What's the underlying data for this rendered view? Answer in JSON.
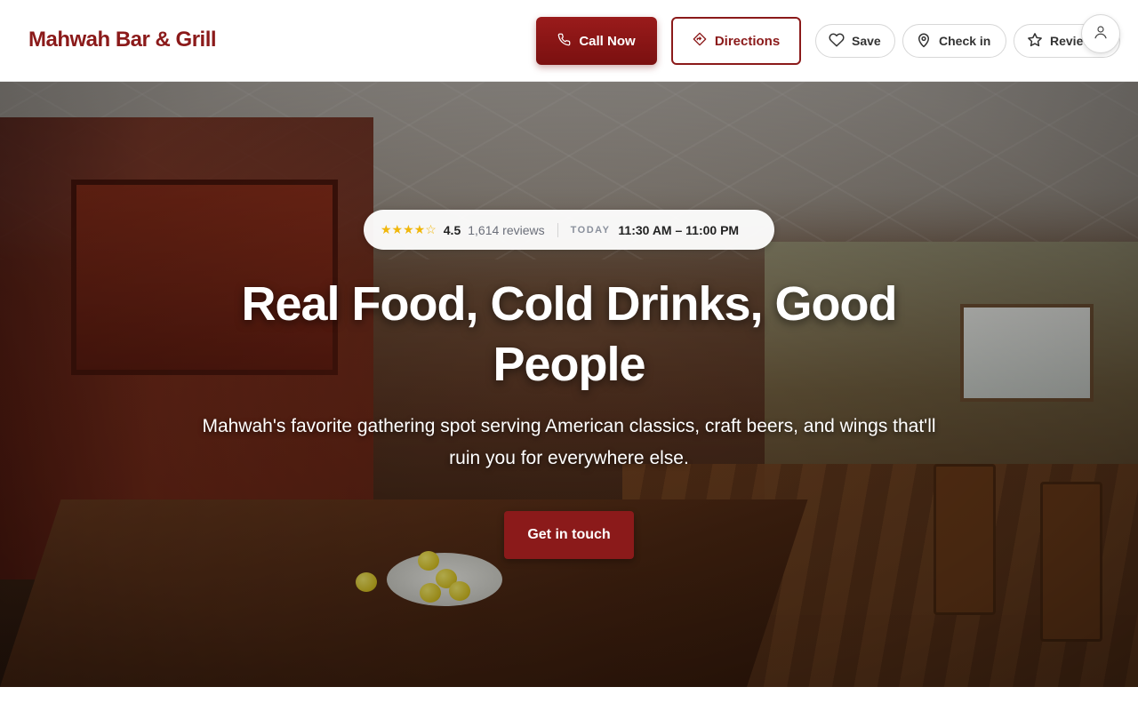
{
  "header": {
    "brand": "Mahwah Bar & Grill",
    "call_label": "Call Now",
    "directions_label": "Directions",
    "save_label": "Save",
    "checkin_label": "Check in",
    "review_label": "Review"
  },
  "hero": {
    "rating_stars": "★★★★☆",
    "rating_value": "4.5",
    "reviews_count": "1,614 reviews",
    "today_label": "TODAY",
    "hours": "11:30 AM – 11:00 PM",
    "headline": "Real Food, Cold Drinks, Good People",
    "subheadline": "Mahwah's favorite gathering spot serving American classics, craft beers, and wings that'll ruin you for everywhere else.",
    "cta_label": "Get in touch"
  },
  "colors": {
    "brand": "#8b1a1a",
    "star": "#f0b70b"
  },
  "icons": {
    "call": "phone-icon",
    "directions": "directions-icon",
    "save": "heart-icon",
    "checkin": "map-pin-icon",
    "review": "star-icon",
    "account": "user-icon"
  }
}
